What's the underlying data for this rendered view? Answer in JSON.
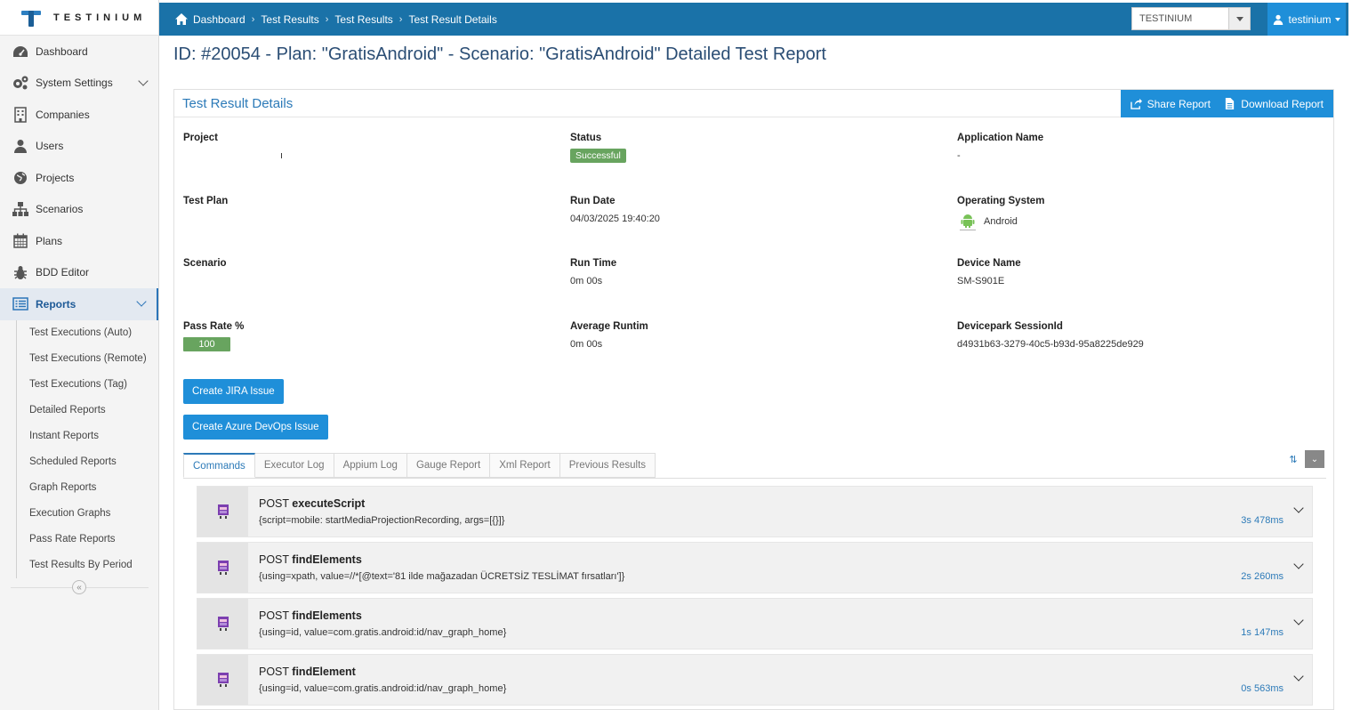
{
  "logo": {
    "text": "TESTINIUM"
  },
  "sidebar": {
    "items": [
      {
        "label": "Dashboard",
        "icon": "dashboard-icon"
      },
      {
        "label": "System Settings",
        "icon": "gears-icon"
      },
      {
        "label": "Companies",
        "icon": "building-icon"
      },
      {
        "label": "Users",
        "icon": "user-icon"
      },
      {
        "label": "Projects",
        "icon": "globe-icon"
      },
      {
        "label": "Scenarios",
        "icon": "sitemap-icon"
      },
      {
        "label": "Plans",
        "icon": "calendar-icon"
      },
      {
        "label": "BDD Editor",
        "icon": "bug-icon"
      },
      {
        "label": "Reports",
        "icon": "list-icon"
      }
    ],
    "reports_sub": [
      "Test Executions (Auto)",
      "Test Executions (Remote)",
      "Test Executions (Tag)",
      "Detailed Reports",
      "Instant Reports",
      "Scheduled Reports",
      "Graph Reports",
      "Execution Graphs",
      "Pass Rate Reports",
      "Test Results By Period"
    ]
  },
  "topbar": {
    "breadcrumb": [
      "Dashboard",
      "Test Results",
      "Test Results",
      "Test Result Details"
    ],
    "org_select": "TESTINIUM",
    "user": "testinium"
  },
  "page": {
    "title": "ID: #20054 - Plan: \"GratisAndroid\" - Scenario: \"GratisAndroid\" Detailed Test Report"
  },
  "panel": {
    "title": "Test Result Details",
    "share_label": "Share Report",
    "download_label": "Download Report"
  },
  "details": {
    "project_label": "Project",
    "project_value": "ı",
    "status_label": "Status",
    "status_value": "Successful",
    "app_label": "Application Name",
    "app_value": "-",
    "plan_label": "Test Plan",
    "plan_value": "",
    "rundate_label": "Run Date",
    "rundate_value": "04/03/2025 19:40:20",
    "os_label": "Operating System",
    "os_value": "Android",
    "scenario_label": "Scenario",
    "scenario_value": "",
    "runtime_label": "Run Time",
    "runtime_value": "0m 00s",
    "device_label": "Device Name",
    "device_value": "SM-S901E",
    "passrate_label": "Pass Rate %",
    "passrate_value": "100",
    "avgrun_label": "Average Runtim",
    "avgrun_value": "0m 00s",
    "session_label": "Devicepark SessionId",
    "session_value": "d4931b63-3279-40c5-b93d-95a8225de929"
  },
  "actions": {
    "jira": "Create JIRA Issue",
    "azure": "Create Azure DevOps Issue"
  },
  "tabs": [
    "Commands",
    "Executor Log",
    "Appium Log",
    "Gauge Report",
    "Xml Report",
    "Previous Results"
  ],
  "commands": [
    {
      "method": "POST",
      "name": "executeScript",
      "args": "{script=mobile: startMediaProjectionRecording, args=[{}]}",
      "time": "3s 478ms"
    },
    {
      "method": "POST",
      "name": "findElements",
      "args": "{using=xpath, value=//*[@text='81 ilde mağazadan ÜCRETSİZ TESLİMAT fırsatları']}",
      "time": "2s 260ms"
    },
    {
      "method": "POST",
      "name": "findElements",
      "args": "{using=id, value=com.gratis.android:id/nav_graph_home}",
      "time": "1s 147ms"
    },
    {
      "method": "POST",
      "name": "findElement",
      "args": "{using=id, value=com.gratis.android:id/nav_graph_home}",
      "time": "0s 563ms"
    }
  ]
}
